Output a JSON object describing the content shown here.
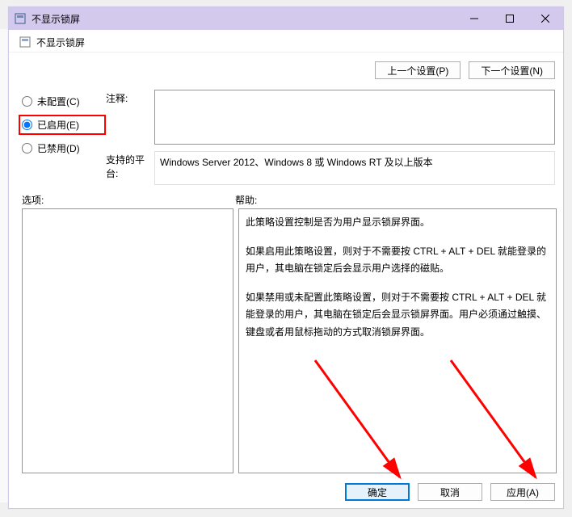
{
  "titlebar": {
    "title": "不显示锁屏"
  },
  "header": {
    "title": "不显示锁屏"
  },
  "nav": {
    "prev": "上一个设置(P)",
    "next": "下一个设置(N)"
  },
  "radios": {
    "notConfigured": "未配置(C)",
    "enabled": "已启用(E)",
    "disabled": "已禁用(D)"
  },
  "labels": {
    "comment": "注释:",
    "platforms": "支持的平台:",
    "options": "选项:",
    "help": "帮助:"
  },
  "platforms": {
    "text": "Windows Server 2012、Windows 8 或 Windows RT 及以上版本"
  },
  "help": {
    "p1": "此策略设置控制是否为用户显示锁屏界面。",
    "p2": "如果启用此策略设置，则对于不需要按 CTRL + ALT + DEL  就能登录的用户，其电脑在锁定后会显示用户选择的磁贴。",
    "p3": "如果禁用或未配置此策略设置，则对于不需要按 CTRL + ALT + DEL 就能登录的用户，其电脑在锁定后会显示锁屏界面。用户必须通过触摸、键盘或者用鼠标拖动的方式取消锁屏界面。"
  },
  "footer": {
    "ok": "确定",
    "cancel": "取消",
    "apply": "应用(A)"
  }
}
